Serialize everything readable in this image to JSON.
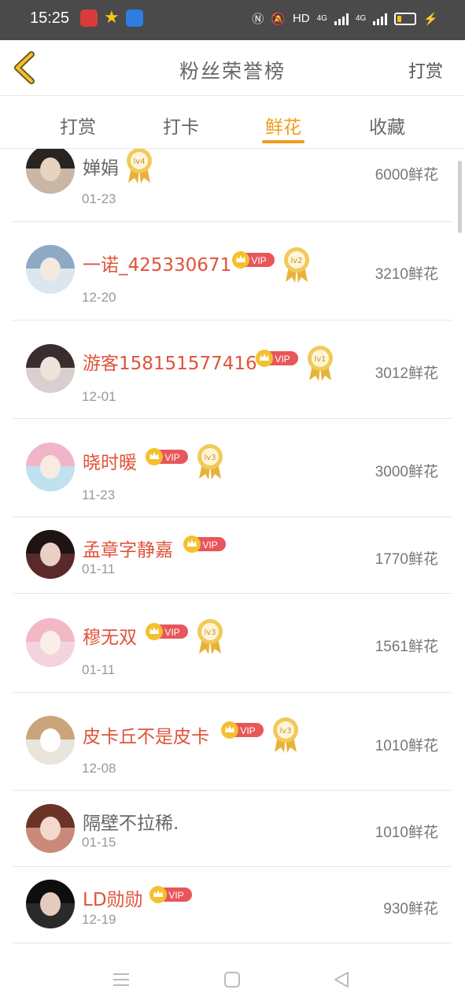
{
  "status_bar": {
    "time": "15:25",
    "hd_label": "HD",
    "net1": "4G",
    "net2": "4G"
  },
  "header": {
    "title": "粉丝荣誉榜",
    "right_action": "打赏"
  },
  "tabs": [
    {
      "label": "打赏",
      "active": false
    },
    {
      "label": "打卡",
      "active": false
    },
    {
      "label": "鲜花",
      "active": true
    },
    {
      "label": "收藏",
      "active": false
    }
  ],
  "badges": {
    "vip_label": "VIP"
  },
  "colors": {
    "accent": "#f29b1e",
    "vip_name": "#e0533a",
    "vip_badge": "#e8565a",
    "medal_gold": "#e8b23a"
  },
  "fans": [
    {
      "name": "婵娟",
      "vip": false,
      "level": "lv4",
      "date": "01-23",
      "amount": "6000鲜花"
    },
    {
      "name": "一诺_425330671",
      "vip": true,
      "level": "lv2",
      "date": "12-20",
      "amount": "3210鲜花"
    },
    {
      "name": "游客158151577416",
      "vip": true,
      "level": "lv1",
      "date": "12-01",
      "amount": "3012鲜花"
    },
    {
      "name": "晓时暖",
      "vip": true,
      "level": "lv3",
      "date": "11-23",
      "amount": "3000鲜花"
    },
    {
      "name": "孟章字静嘉",
      "vip": true,
      "level": "",
      "date": "01-11",
      "amount": "1770鲜花"
    },
    {
      "name": "穆无双",
      "vip": true,
      "level": "lv3",
      "date": "01-11",
      "amount": "1561鲜花"
    },
    {
      "name": "皮卡丘不是皮卡",
      "vip": true,
      "level": "lv3",
      "date": "12-08",
      "amount": "1010鲜花"
    },
    {
      "name": "隔壁不拉稀.",
      "vip": false,
      "level": "",
      "date": "01-15",
      "amount": "1010鲜花"
    },
    {
      "name": "LD勋勋",
      "vip": true,
      "level": "",
      "date": "12-19",
      "amount": "930鲜花"
    }
  ]
}
